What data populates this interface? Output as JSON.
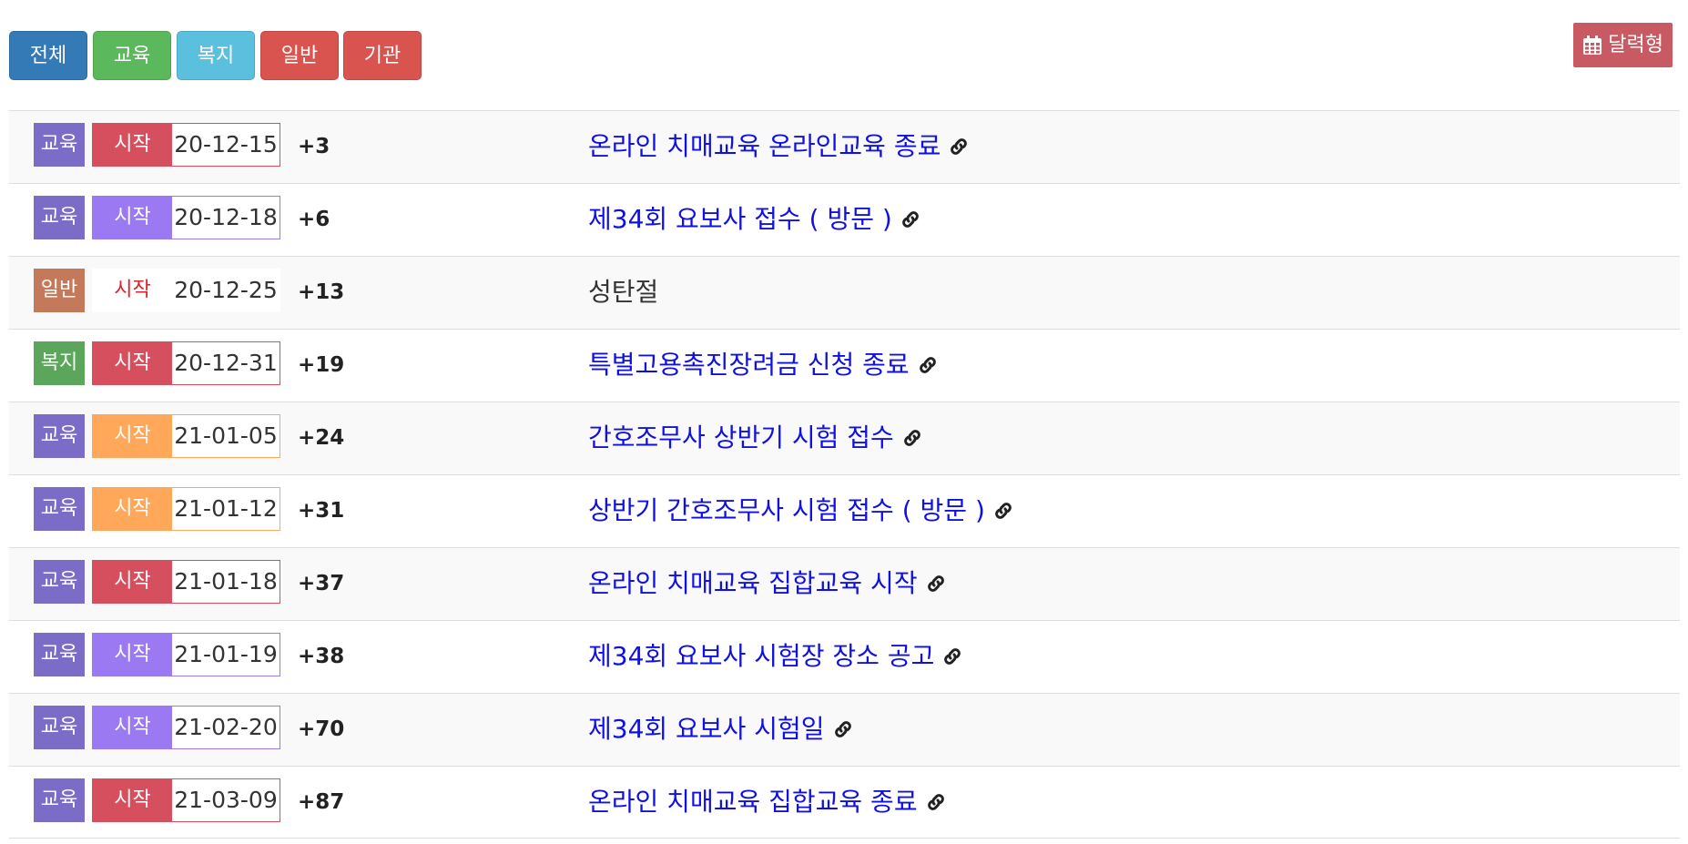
{
  "filters": [
    {
      "label": "전체",
      "color": "#337ab7"
    },
    {
      "label": "교육",
      "color": "#5cb85c"
    },
    {
      "label": "복지",
      "color": "#5bc0de"
    },
    {
      "label": "일반",
      "color": "#d9534f"
    },
    {
      "label": "기관",
      "color": "#d9534f"
    }
  ],
  "calendar_button": {
    "label": "달력형",
    "icon": "calendar-icon",
    "color": "#c85a63"
  },
  "events": [
    {
      "category": "교육",
      "category_color": "#7b6cc7",
      "status": "시작",
      "status_bg": "#d64f5f",
      "status_color": "#ffffff",
      "border_color": "#d64f5f",
      "date": "20-12-15",
      "offset": "+3",
      "title": "온라인 치매교육 온라인교육 종료",
      "linked": true
    },
    {
      "category": "교육",
      "category_color": "#7b6cc7",
      "status": "시작",
      "status_bg": "#9b79f2",
      "status_color": "#ffffff",
      "border_color": "#9b79f2",
      "date": "20-12-18",
      "offset": "+6",
      "title": "제34회 요보사 접수 ( 방문 )",
      "linked": true
    },
    {
      "category": "일반",
      "category_color": "#c47a5a",
      "status": "시작",
      "status_bg": "#ffffff",
      "status_color": "#e0202a",
      "border_color": "#ffffff",
      "date": "20-12-25",
      "offset": "+13",
      "title": "성탄절",
      "linked": false
    },
    {
      "category": "복지",
      "category_color": "#5ca65c",
      "status": "시작",
      "status_bg": "#d64f5f",
      "status_color": "#ffffff",
      "border_color": "#d64f5f",
      "date": "20-12-31",
      "offset": "+19",
      "title": "특별고용촉진장려금 신청 종료",
      "linked": true
    },
    {
      "category": "교육",
      "category_color": "#7b6cc7",
      "status": "시작",
      "status_bg": "#ffa85a",
      "status_color": "#ffffff",
      "border_color": "#ffa85a",
      "date": "21-01-05",
      "offset": "+24",
      "title": "간호조무사 상반기 시험 접수",
      "linked": true
    },
    {
      "category": "교육",
      "category_color": "#7b6cc7",
      "status": "시작",
      "status_bg": "#ffa85a",
      "status_color": "#ffffff",
      "border_color": "#ffa85a",
      "date": "21-01-12",
      "offset": "+31",
      "title": "상반기 간호조무사 시험 접수 ( 방문 )",
      "linked": true
    },
    {
      "category": "교육",
      "category_color": "#7b6cc7",
      "status": "시작",
      "status_bg": "#d64f5f",
      "status_color": "#ffffff",
      "border_color": "#d64f5f",
      "date": "21-01-18",
      "offset": "+37",
      "title": "온라인 치매교육 집합교육 시작",
      "linked": true
    },
    {
      "category": "교육",
      "category_color": "#7b6cc7",
      "status": "시작",
      "status_bg": "#9b79f2",
      "status_color": "#ffffff",
      "border_color": "#9b79f2",
      "date": "21-01-19",
      "offset": "+38",
      "title": "제34회 요보사 시험장 장소 공고",
      "linked": true
    },
    {
      "category": "교육",
      "category_color": "#7b6cc7",
      "status": "시작",
      "status_bg": "#9b79f2",
      "status_color": "#ffffff",
      "border_color": "#9b79f2",
      "date": "21-02-20",
      "offset": "+70",
      "title": "제34회 요보사 시험일",
      "linked": true
    },
    {
      "category": "교육",
      "category_color": "#7b6cc7",
      "status": "시작",
      "status_bg": "#d64f5f",
      "status_color": "#ffffff",
      "border_color": "#d64f5f",
      "date": "21-03-09",
      "offset": "+87",
      "title": "온라인 치매교육 집합교육 종료",
      "linked": true
    }
  ]
}
